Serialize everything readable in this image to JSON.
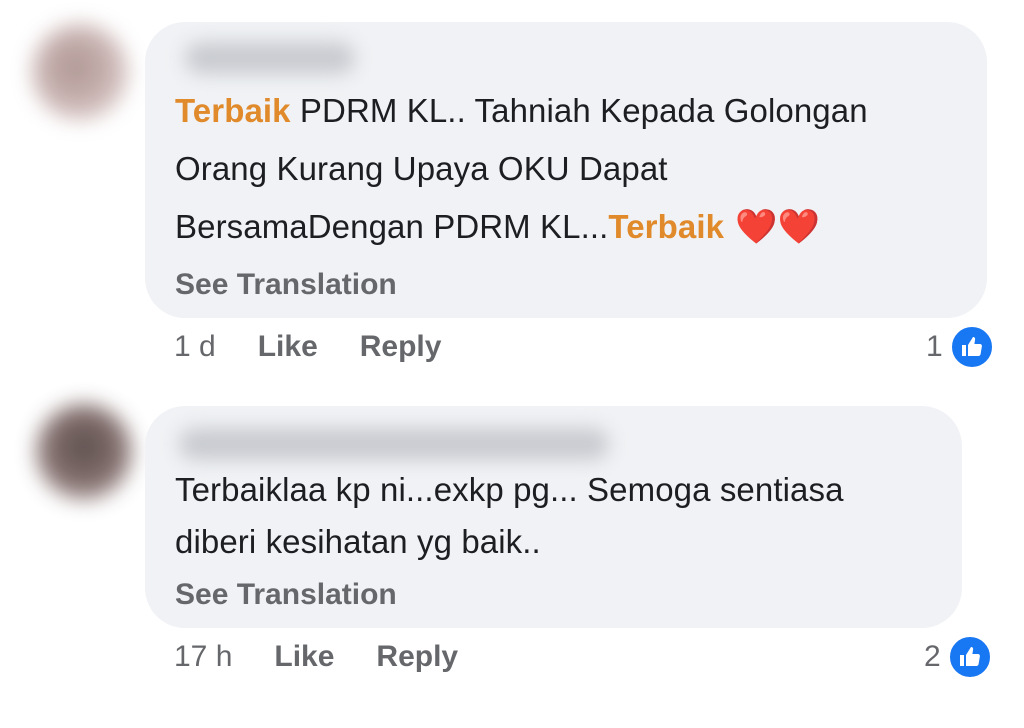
{
  "comments": [
    {
      "segments": {
        "s1": "Terbaik",
        "s2": " PDRM KL.. Tahniah Kepada Golongan",
        "s3": "Orang Kurang Upaya OKU Dapat",
        "s4": "BersamaDengan PDRM KL...",
        "s5": "Terbaik",
        "hearts": "❤️❤️"
      },
      "see_translation": "See Translation",
      "time": "1 d",
      "like_label": "Like",
      "reply_label": "Reply",
      "reaction_count": "1",
      "reaction_icon": "thumbs-up-icon"
    },
    {
      "line1": "Terbaiklaa kp ni...exkp pg... Semoga sentiasa",
      "line2": "diberi kesihatan yg baik..",
      "see_translation": "See Translation",
      "time": "17 h",
      "like_label": "Like",
      "reply_label": "Reply",
      "reaction_count": "2",
      "reaction_icon": "thumbs-up-icon"
    }
  ],
  "colors": {
    "highlight": "#e08a2b",
    "bubble": "#f0f2f5",
    "meta_text": "#65676b",
    "like_blue": "#1877f2"
  }
}
